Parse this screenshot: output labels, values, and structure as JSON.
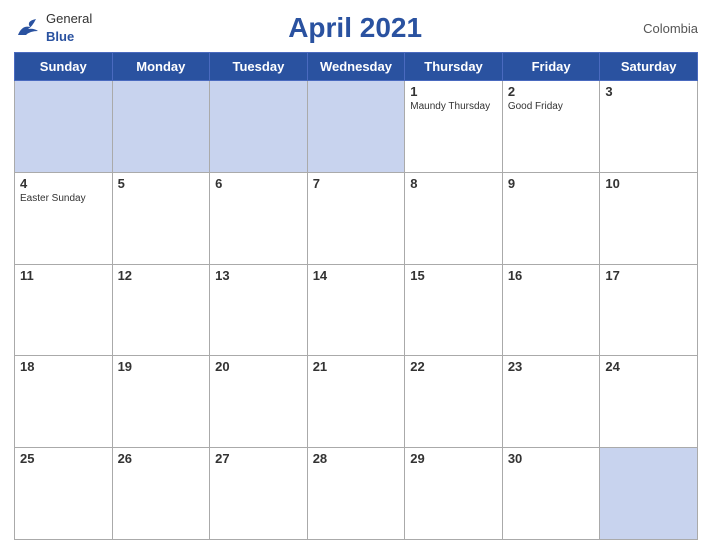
{
  "header": {
    "logo_general": "General",
    "logo_blue": "Blue",
    "title": "April 2021",
    "country": "Colombia"
  },
  "days_of_week": [
    "Sunday",
    "Monday",
    "Tuesday",
    "Wednesday",
    "Thursday",
    "Friday",
    "Saturday"
  ],
  "weeks": [
    [
      {
        "day": "",
        "holiday": ""
      },
      {
        "day": "",
        "holiday": ""
      },
      {
        "day": "",
        "holiday": ""
      },
      {
        "day": "",
        "holiday": ""
      },
      {
        "day": "1",
        "holiday": "Maundy Thursday"
      },
      {
        "day": "2",
        "holiday": "Good Friday"
      },
      {
        "day": "3",
        "holiday": ""
      }
    ],
    [
      {
        "day": "4",
        "holiday": "Easter Sunday"
      },
      {
        "day": "5",
        "holiday": ""
      },
      {
        "day": "6",
        "holiday": ""
      },
      {
        "day": "7",
        "holiday": ""
      },
      {
        "day": "8",
        "holiday": ""
      },
      {
        "day": "9",
        "holiday": ""
      },
      {
        "day": "10",
        "holiday": ""
      }
    ],
    [
      {
        "day": "11",
        "holiday": ""
      },
      {
        "day": "12",
        "holiday": ""
      },
      {
        "day": "13",
        "holiday": ""
      },
      {
        "day": "14",
        "holiday": ""
      },
      {
        "day": "15",
        "holiday": ""
      },
      {
        "day": "16",
        "holiday": ""
      },
      {
        "day": "17",
        "holiday": ""
      }
    ],
    [
      {
        "day": "18",
        "holiday": ""
      },
      {
        "day": "19",
        "holiday": ""
      },
      {
        "day": "20",
        "holiday": ""
      },
      {
        "day": "21",
        "holiday": ""
      },
      {
        "day": "22",
        "holiday": ""
      },
      {
        "day": "23",
        "holiday": ""
      },
      {
        "day": "24",
        "holiday": ""
      }
    ],
    [
      {
        "day": "25",
        "holiday": ""
      },
      {
        "day": "26",
        "holiday": ""
      },
      {
        "day": "27",
        "holiday": ""
      },
      {
        "day": "28",
        "holiday": ""
      },
      {
        "day": "29",
        "holiday": ""
      },
      {
        "day": "30",
        "holiday": ""
      },
      {
        "day": "",
        "holiday": ""
      }
    ]
  ]
}
